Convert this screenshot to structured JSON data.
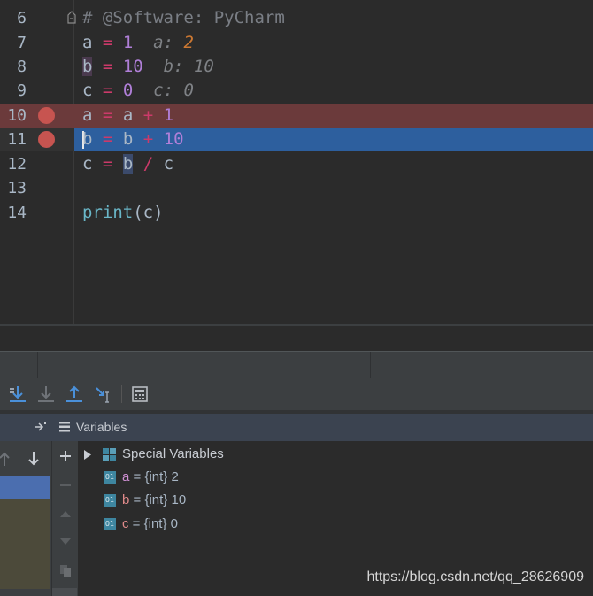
{
  "editor": {
    "lines": [
      {
        "num": "6",
        "text": "# @Software: PyCharm"
      },
      {
        "num": "7",
        "var": "a",
        "eq": "=",
        "val": "1",
        "hint_name": "a:",
        "hint_val": "2"
      },
      {
        "num": "8",
        "var": "b",
        "eq": "=",
        "val": "10",
        "hint_name": "b:",
        "hint_val": "10"
      },
      {
        "num": "9",
        "var": "c",
        "eq": "=",
        "val": "0",
        "hint_name": "c:",
        "hint_val": "0"
      },
      {
        "num": "10",
        "var": "a",
        "eq": "=",
        "rhs_var": "a",
        "op": "+",
        "val": "1",
        "breakpoint": true
      },
      {
        "num": "11",
        "var": "b",
        "eq": "=",
        "rhs_var": "b",
        "op": "+",
        "val": "10",
        "breakpoint": true,
        "current": true
      },
      {
        "num": "12",
        "var": "c",
        "eq": "=",
        "rhs_var": "b",
        "op": "/",
        "rhs_var2": "c"
      },
      {
        "num": "13"
      },
      {
        "num": "14",
        "func": "print",
        "open": "(",
        "arg": "c",
        "close": ")"
      }
    ]
  },
  "toolbar": {
    "icons": [
      "step-over-icon",
      "step-into-icon",
      "step-out-icon",
      "run-to-cursor-icon",
      "evaluate-expression-icon"
    ]
  },
  "variables_panel": {
    "title": "Variables",
    "items": [
      {
        "name": "Special Variables",
        "expandable": true
      },
      {
        "name": "a",
        "type": "{int}",
        "value": "2",
        "icon": "01"
      },
      {
        "name": "b",
        "type": "{int}",
        "value": "10",
        "icon": "01"
      },
      {
        "name": "c",
        "type": "{int}",
        "value": "0",
        "icon": "01"
      }
    ]
  },
  "watermark": "https://blog.csdn.net/qq_28626909",
  "colors": {
    "breakpoint": "#c75450",
    "current_line": "#2d5f9e",
    "breakpoint_line": "#6b3a3b"
  }
}
